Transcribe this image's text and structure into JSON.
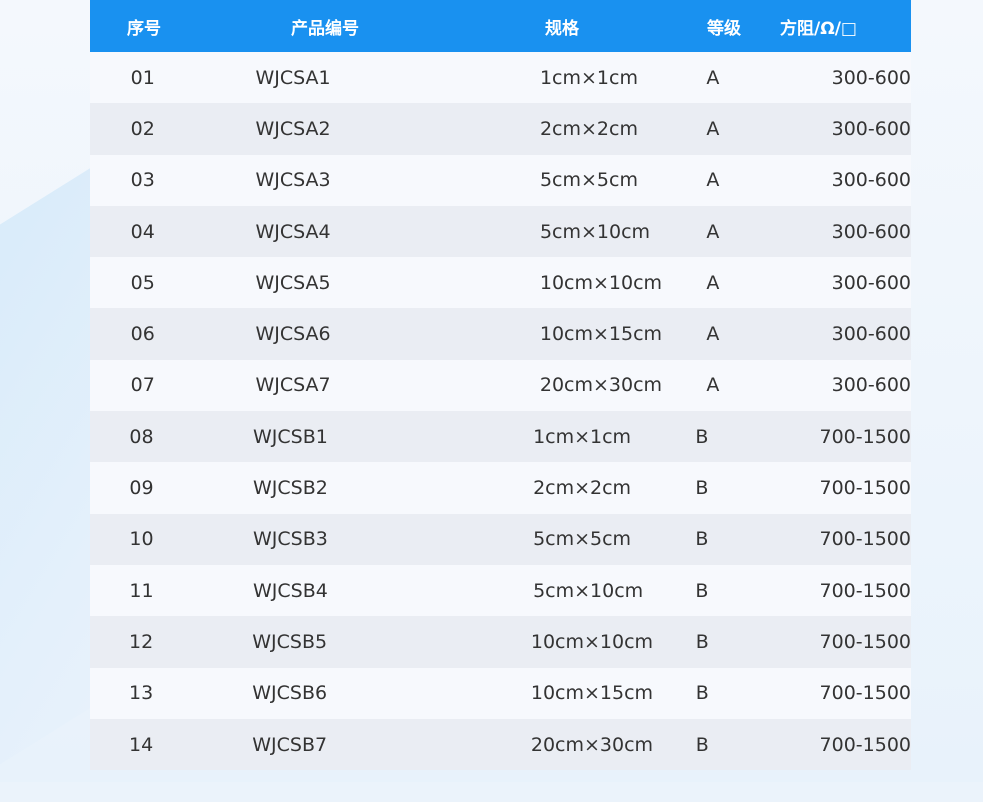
{
  "table": {
    "headers": [
      "序号",
      "产品编号",
      "规格",
      "等级",
      "方阻/Ω/□"
    ],
    "rows": [
      [
        "01",
        "WJCSA1",
        "1cm×1cm",
        "A",
        "300-600"
      ],
      [
        "02",
        "WJCSA2",
        "2cm×2cm",
        "A",
        "300-600"
      ],
      [
        "03",
        "WJCSA3",
        "5cm×5cm",
        "A",
        "300-600"
      ],
      [
        "04",
        "WJCSA4",
        "5cm×10cm",
        "A",
        "300-600"
      ],
      [
        "05",
        "WJCSA5",
        "10cm×10cm",
        "A",
        "300-600"
      ],
      [
        "06",
        "WJCSA6",
        "10cm×15cm",
        "A",
        "300-600"
      ],
      [
        "07",
        "WJCSA7",
        "20cm×30cm",
        "A",
        "300-600"
      ],
      [
        "08",
        "WJCSB1",
        "1cm×1cm",
        "B",
        "700-1500"
      ],
      [
        "09",
        "WJCSB2",
        "2cm×2cm",
        "B",
        "700-1500"
      ],
      [
        "10",
        "WJCSB3",
        "5cm×5cm",
        "B",
        "700-1500"
      ],
      [
        "11",
        "WJCSB4",
        "5cm×10cm",
        "B",
        "700-1500"
      ],
      [
        "12",
        "WJCSB5",
        "10cm×10cm",
        "B",
        "700-1500"
      ],
      [
        "13",
        "WJCSB6",
        "10cm×15cm",
        "B",
        "700-1500"
      ],
      [
        "14",
        "WJCSB7",
        "20cm×30cm",
        "B",
        "700-1500"
      ]
    ]
  },
  "colors": {
    "header_bg": "#1991f0",
    "header_text": "#ffffff",
    "row_odd_bg": "#f7f9fd",
    "row_even_bg": "#eaedf3",
    "body_text": "#333333"
  }
}
